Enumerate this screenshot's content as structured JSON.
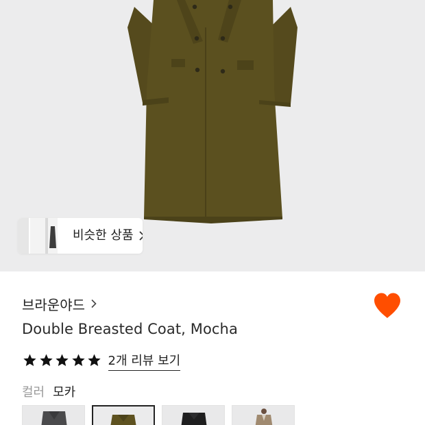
{
  "similar": {
    "label": "비슷한 상품"
  },
  "product": {
    "brand": "브라운야드",
    "title": "Double Breasted Coat, Mocha",
    "rating_stars": 5,
    "review_link": "2개 리뷰 보기",
    "wishlisted": true
  },
  "color_option": {
    "label": "컬러",
    "selected": "모카",
    "swatches": [
      {
        "name": "charcoal",
        "color": "#4a4a4c"
      },
      {
        "name": "mocha",
        "color": "#5e5220"
      },
      {
        "name": "black",
        "color": "#1e1e1f"
      },
      {
        "name": "camel",
        "color": "#a08a70"
      }
    ]
  },
  "colors": {
    "accent": "#ff4e00",
    "coat": "#5a4f1f",
    "hero_bg": "#ececed"
  }
}
